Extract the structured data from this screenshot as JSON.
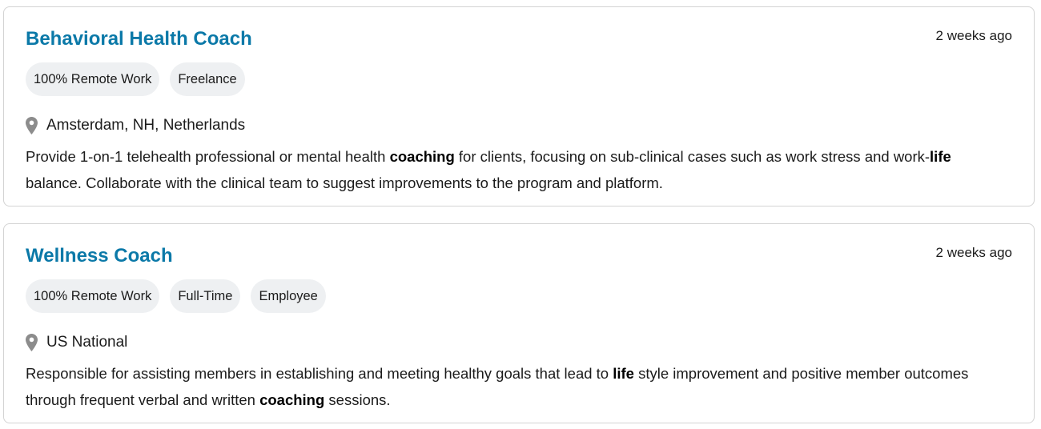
{
  "colors": {
    "title": "#0b79a8",
    "tag_bg": "#eef0f2",
    "text": "#1b1b1b",
    "border": "#d3d3d3",
    "pin": "#8c8c8c"
  },
  "jobs": [
    {
      "title": "Behavioral Health Coach",
      "posted": "2 weeks ago",
      "tags": [
        "100% Remote Work",
        "Freelance"
      ],
      "location_icon": "map-pin-icon",
      "location": "Amsterdam, NH, Netherlands",
      "description": [
        {
          "text": "Provide 1-on-1 telehealth professional or mental health ",
          "bold": false
        },
        {
          "text": "coaching",
          "bold": true
        },
        {
          "text": " for clients, focusing on sub-clinical cases such as work stress and work-",
          "bold": false
        },
        {
          "text": "life",
          "bold": true
        },
        {
          "text": " balance. Collaborate with the clinical team to suggest improvements to the program and platform.",
          "bold": false
        }
      ]
    },
    {
      "title": "Wellness Coach",
      "posted": "2 weeks ago",
      "tags": [
        "100% Remote Work",
        "Full-Time",
        "Employee"
      ],
      "location_icon": "map-pin-icon",
      "location": "US National",
      "description": [
        {
          "text": "Responsible for assisting members in establishing and meeting healthy goals that lead to ",
          "bold": false
        },
        {
          "text": "life",
          "bold": true
        },
        {
          "text": " style improvement and positive member outcomes through frequent verbal and written ",
          "bold": false
        },
        {
          "text": "coaching",
          "bold": true
        },
        {
          "text": " sessions.",
          "bold": false
        }
      ]
    }
  ]
}
